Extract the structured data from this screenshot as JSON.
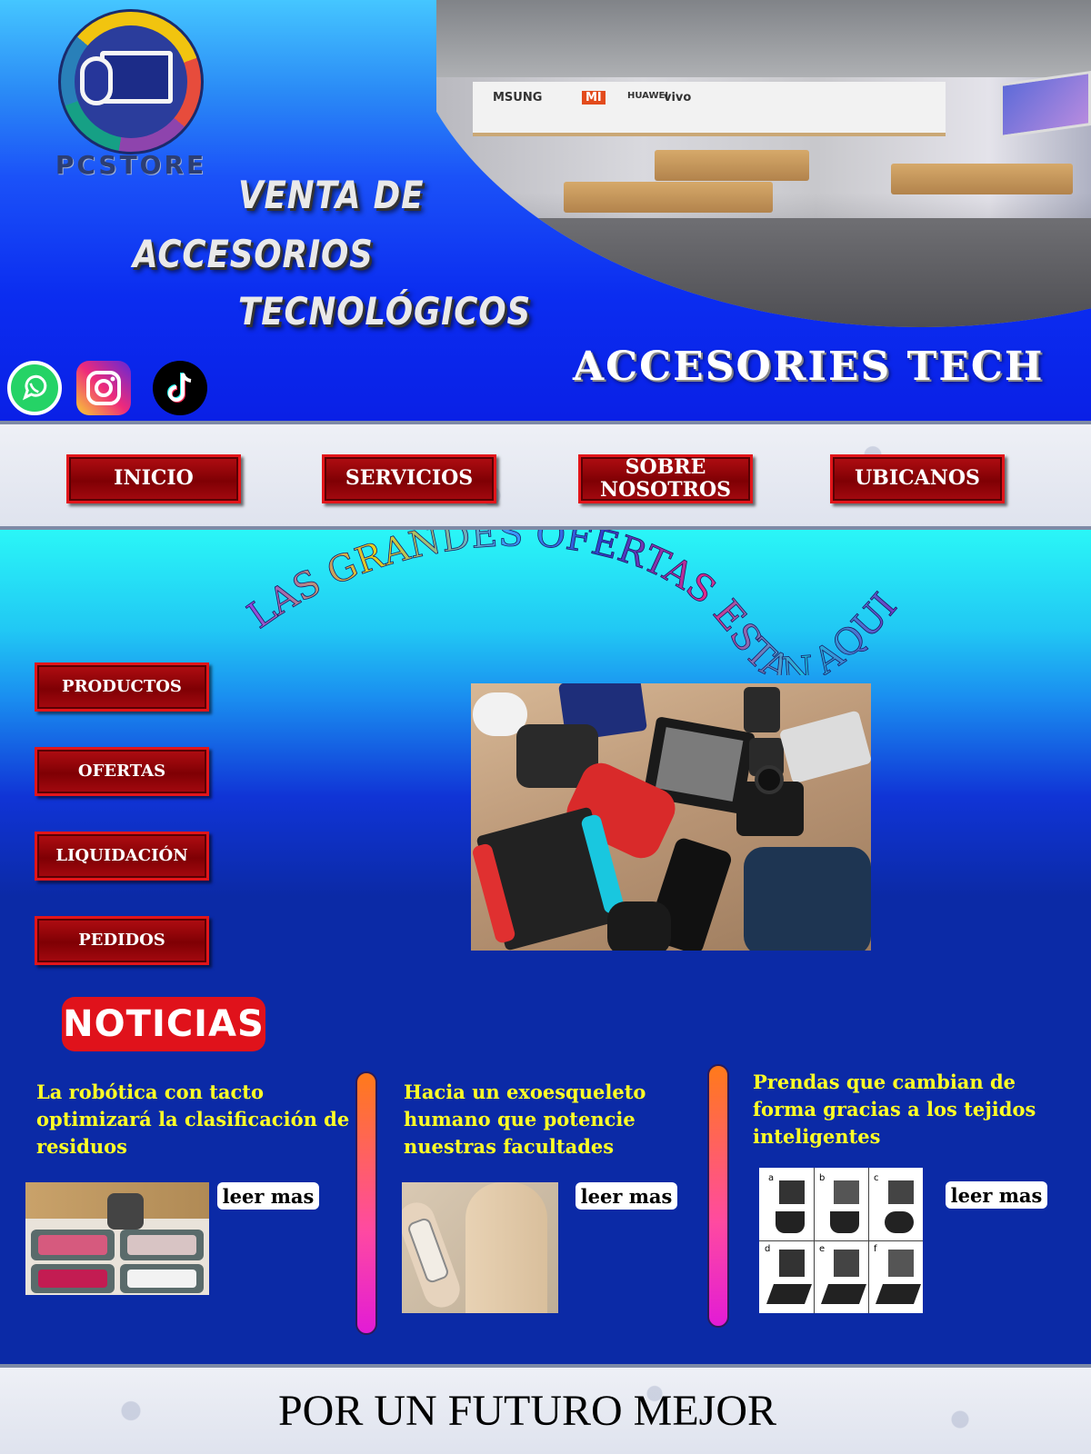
{
  "header": {
    "logo_text": "PCSTORE",
    "hero_lines": [
      "VENTA DE",
      "ACCESORIOS",
      "TECNOLÓGICOS"
    ],
    "brand_title": "ACCESORIES TECH",
    "store_brands": [
      "MSUNG",
      "MI",
      "HUAWEI",
      "vivo"
    ],
    "social": [
      {
        "name": "whatsapp",
        "icon": "whatsapp-icon"
      },
      {
        "name": "instagram",
        "icon": "instagram-icon"
      },
      {
        "name": "tiktok",
        "icon": "tiktok-icon"
      }
    ]
  },
  "nav": {
    "items": [
      {
        "label": "INICIO"
      },
      {
        "label": "SERVICIOS"
      },
      {
        "label_lines": [
          "SOBRE",
          "NOSOTROS"
        ]
      },
      {
        "label": "UBICANOS"
      }
    ]
  },
  "main": {
    "banner": "LAS GRANDES OFERTAS ESTAN AQUI",
    "side_buttons": [
      {
        "label": "PRODUCTOS"
      },
      {
        "label": "OFERTAS"
      },
      {
        "label": "LIQUIDACIÓN"
      },
      {
        "label": "PEDIDOS"
      }
    ],
    "news_heading": "NOTICIAS",
    "news": [
      {
        "title_lines": [
          "La robótica con tacto",
          "optimizará la clasificación de",
          "residuos"
        ],
        "link": "leer mas"
      },
      {
        "title_lines": [
          "Hacia un exoesqueleto",
          "humano que potencie",
          "nuestras facultades"
        ],
        "link": "leer mas"
      },
      {
        "title_lines": [
          "Prendas que cambian de",
          "forma gracias a los tejidos",
          "inteligentes"
        ],
        "link": "leer mas"
      }
    ],
    "figure_labels": [
      "a",
      "b",
      "c",
      "d",
      "e",
      "f"
    ]
  },
  "footer": {
    "text": "POR UN FUTURO MEJOR"
  },
  "colors": {
    "button_red": "#7f0004",
    "news_yellow": "#ffff26",
    "noticias_red": "#e0121b",
    "header_blue": "#0a20e6",
    "main_cyan": "#2af6f7"
  }
}
